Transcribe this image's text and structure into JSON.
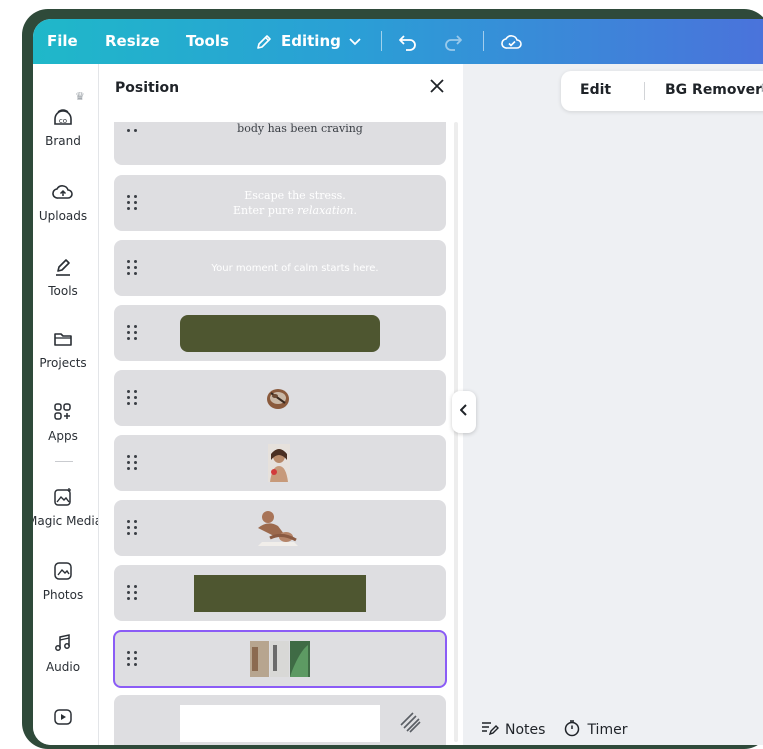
{
  "topbar": {
    "file": "File",
    "resize": "Resize",
    "tools": "Tools",
    "editing": "Editing"
  },
  "rail": {
    "items": [
      {
        "label": "Brand",
        "icon": "brand-kit-icon"
      },
      {
        "label": "Uploads",
        "icon": "cloud-upload-icon"
      },
      {
        "label": "Tools",
        "icon": "pen-tool-icon"
      },
      {
        "label": "Projects",
        "icon": "folder-icon"
      },
      {
        "label": "Apps",
        "icon": "apps-grid-icon"
      },
      {
        "label": "Magic Media",
        "icon": "magic-image-icon"
      },
      {
        "label": "Photos",
        "icon": "photo-icon"
      },
      {
        "label": "Audio",
        "icon": "music-note-icon"
      }
    ]
  },
  "panel": {
    "title": "Position",
    "layers": [
      {
        "kind": "text",
        "text": "body has been craving",
        "style": "dark-serif"
      },
      {
        "kind": "text",
        "line1": "Escape the stress.",
        "line2a": "Enter pure ",
        "line2b": "relaxation."
      },
      {
        "kind": "text",
        "text": "Your moment of calm starts here."
      },
      {
        "kind": "shape",
        "color": "#4e5630"
      },
      {
        "kind": "image",
        "desc": "bowl"
      },
      {
        "kind": "image",
        "desc": "portrait"
      },
      {
        "kind": "image",
        "desc": "massage"
      },
      {
        "kind": "shape",
        "color": "#4e5630"
      },
      {
        "kind": "image",
        "desc": "collage",
        "selected": true
      },
      {
        "kind": "shape",
        "color": "#ffffff"
      }
    ]
  },
  "edit_pill": {
    "edit": "Edit",
    "bg_remover": "BG Remover"
  },
  "bottom": {
    "notes": "Notes",
    "timer": "Timer"
  },
  "colors": {
    "accent": "#8b5cf6",
    "topbar_start": "#1fb8c9",
    "topbar_end": "#4a73db",
    "frame": "#2f4a3a",
    "olive": "#4e5630"
  }
}
